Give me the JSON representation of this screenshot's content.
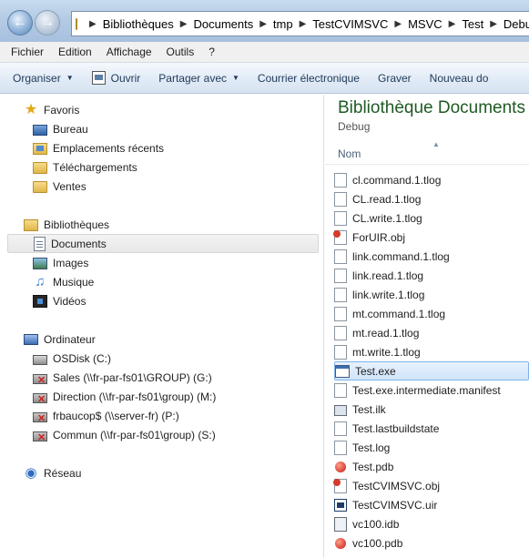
{
  "address": {
    "breadcrumbs": [
      "Bibliothèques",
      "Documents",
      "tmp",
      "TestCVIMSVC",
      "MSVC",
      "Test",
      "Debug"
    ]
  },
  "menu": {
    "items": [
      "Fichier",
      "Edition",
      "Affichage",
      "Outils",
      "?"
    ]
  },
  "toolbar": {
    "organiser": "Organiser",
    "ouvrir": "Ouvrir",
    "partager": "Partager avec",
    "courrier": "Courrier électronique",
    "graver": "Graver",
    "nouveau": "Nouveau do"
  },
  "nav": {
    "favoris": {
      "label": "Favoris",
      "items": [
        "Bureau",
        "Emplacements récents",
        "Téléchargements",
        "Ventes"
      ]
    },
    "bibliotheques": {
      "label": "Bibliothèques",
      "items": [
        "Documents",
        "Images",
        "Musique",
        "Vidéos"
      ],
      "selected": "Documents"
    },
    "ordinateur": {
      "label": "Ordinateur",
      "items": [
        "OSDisk (C:)",
        "Sales (\\\\fr-par-fs01\\GROUP) (G:)",
        "Direction (\\\\fr-par-fs01\\group) (M:)",
        "frbaucop$ (\\\\server-fr) (P:)",
        "Commun (\\\\fr-par-fs01\\group) (S:)"
      ]
    },
    "reseau": {
      "label": "Réseau"
    }
  },
  "content": {
    "title": "Bibliothèque Documents",
    "subtitle": "Debug",
    "column_header": "Nom",
    "selected": "Test.exe",
    "files": [
      "cl.command.1.tlog",
      "CL.read.1.tlog",
      "CL.write.1.tlog",
      "ForUIR.obj",
      "link.command.1.tlog",
      "link.read.1.tlog",
      "link.write.1.tlog",
      "mt.command.1.tlog",
      "mt.read.1.tlog",
      "mt.write.1.tlog",
      "Test.exe",
      "Test.exe.intermediate.manifest",
      "Test.ilk",
      "Test.lastbuildstate",
      "Test.log",
      "Test.pdb",
      "TestCVIMSVC.obj",
      "TestCVIMSVC.uir",
      "vc100.idb",
      "vc100.pdb"
    ]
  }
}
